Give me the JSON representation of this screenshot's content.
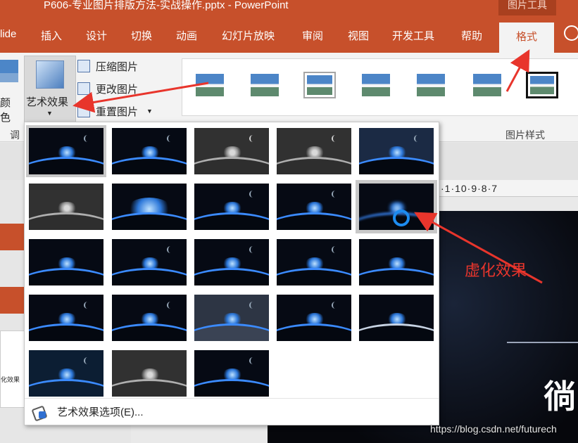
{
  "window": {
    "title": "P606-专业图片排版方法-实战操作.pptx  -  PowerPoint",
    "context_tab_group": "图片工具"
  },
  "tabs": [
    {
      "label": "lide"
    },
    {
      "label": "插入"
    },
    {
      "label": "设计"
    },
    {
      "label": "切换"
    },
    {
      "label": "动画"
    },
    {
      "label": "幻灯片放映"
    },
    {
      "label": "审阅"
    },
    {
      "label": "视图"
    },
    {
      "label": "开发工具"
    },
    {
      "label": "帮助"
    },
    {
      "label": "格式",
      "active": true
    }
  ],
  "ribbon": {
    "color_label": "颜色",
    "artistic_effects_label": "艺术效果",
    "compress_label": "压缩图片",
    "change_label": "更改图片",
    "reset_label": "重置图片",
    "adjust_group_label": "调",
    "styles_group_label": "图片样式"
  },
  "ruler": {
    "text": "·1·10·9·8·7"
  },
  "left_panel": {
    "thumb_text": "化效果"
  },
  "dropdown": {
    "options_label": "艺术效果选项(E)...",
    "thumbnails": [
      {
        "name": "none"
      },
      {
        "name": "marker"
      },
      {
        "name": "pencil-grayscale"
      },
      {
        "name": "pencil-sketch"
      },
      {
        "name": "line-drawing"
      },
      {
        "name": "chalk-sketch"
      },
      {
        "name": "paint-strokes"
      },
      {
        "name": "paint-brush"
      },
      {
        "name": "glow-diffused"
      },
      {
        "name": "blur"
      },
      {
        "name": "light-screen"
      },
      {
        "name": "watercolor-sponge"
      },
      {
        "name": "film-grain"
      },
      {
        "name": "mosaic-bubbles"
      },
      {
        "name": "glass"
      },
      {
        "name": "cement"
      },
      {
        "name": "texturizer"
      },
      {
        "name": "crisscross-etching"
      },
      {
        "name": "pastels-smooth"
      },
      {
        "name": "plastic-wrap"
      },
      {
        "name": "cutout"
      },
      {
        "name": "photocopy"
      },
      {
        "name": "glow-edges"
      }
    ]
  },
  "annotation": {
    "text": "虚化效果"
  },
  "watermark": "https://blog.csdn.net/futurech",
  "colors": {
    "accent": "#c7502b",
    "annotation_red": "#e8352c"
  }
}
